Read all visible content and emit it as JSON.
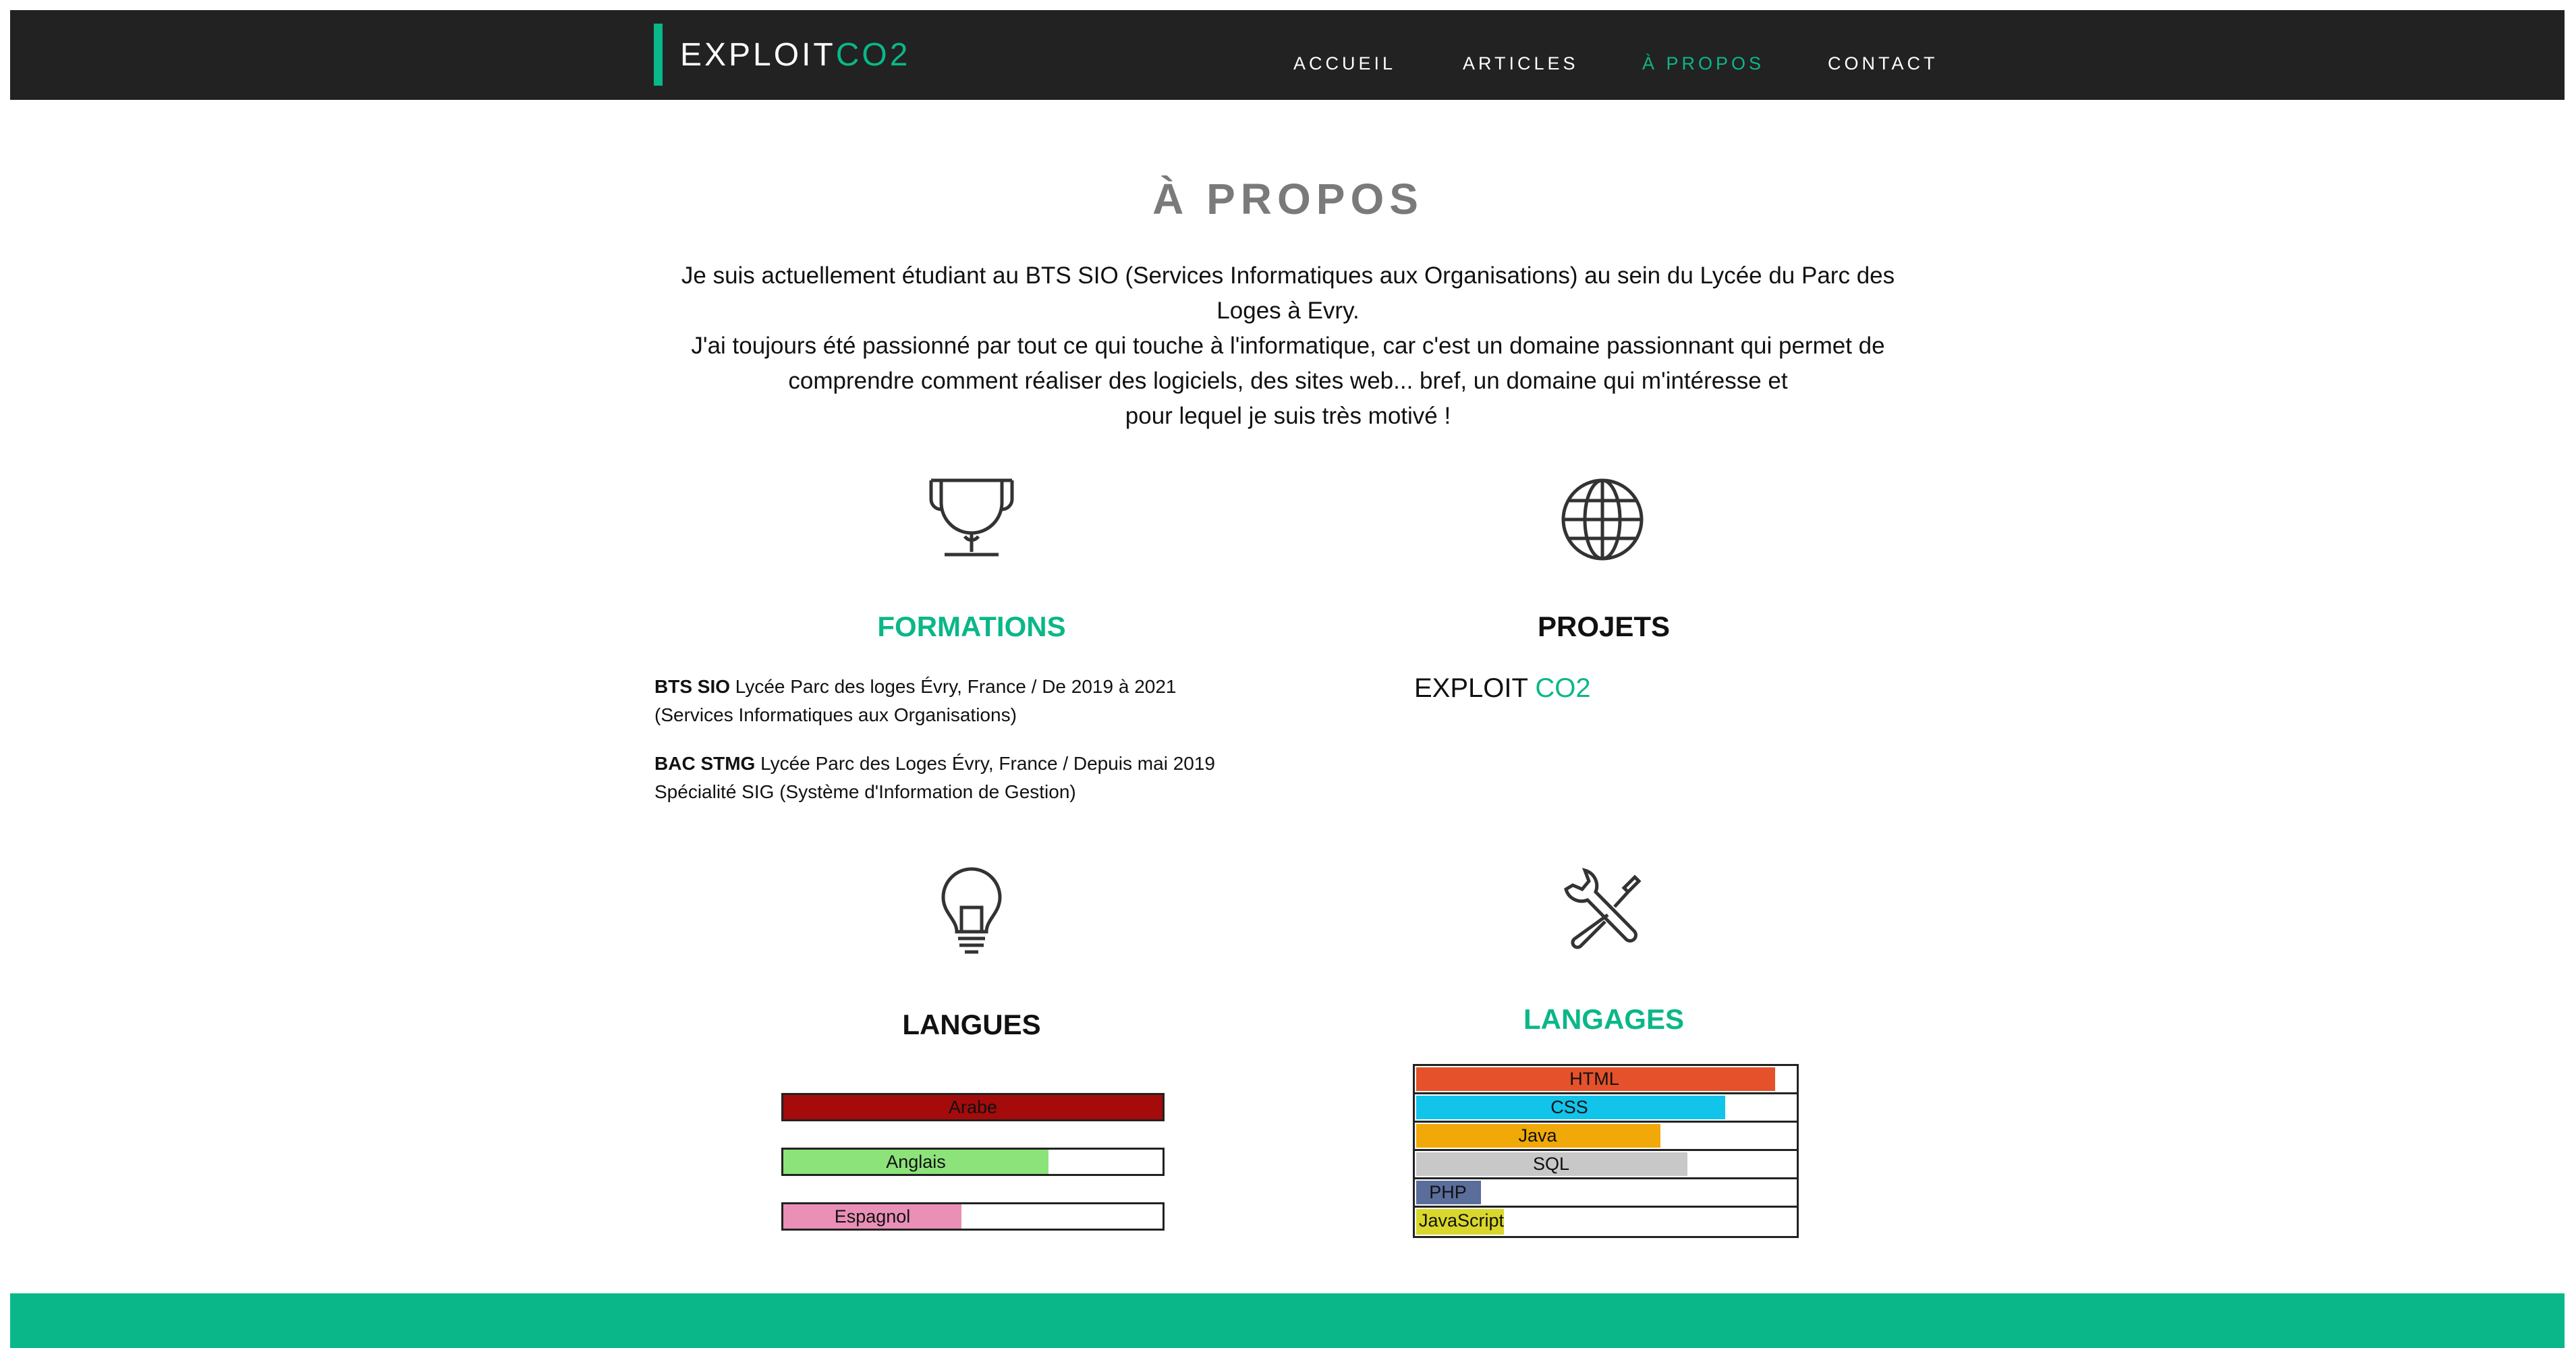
{
  "brand": {
    "name": "EXPLOIT",
    "accent": "CO2"
  },
  "nav": {
    "items": [
      {
        "label": "ACCUEIL"
      },
      {
        "label": "ARTICLES"
      },
      {
        "label": "À PROPOS"
      },
      {
        "label": "CONTACT"
      }
    ],
    "active": "À PROPOS"
  },
  "page": {
    "title": "À PROPOS",
    "intro": [
      "Je suis actuellement étudiant au BTS SIO (Services Informatiques aux Organisations) au sein du Lycée du Parc des Loges à Evry.",
      "J'ai toujours été passionné par tout ce qui touche à l'informatique, car c'est un domaine passionnant qui permet de comprendre comment réaliser des logiciels, des sites web... bref, un domaine qui m'intéresse et",
      "pour lequel je suis très motivé !"
    ]
  },
  "sections": {
    "formations": {
      "title": "FORMATIONS",
      "items": [
        {
          "degree": "BTS SIO",
          "text": " Lycée Parc des loges Évry, France / De 2019 à 2021",
          "detail": "(Services Informatiques aux Organisations)"
        },
        {
          "degree": "BAC STMG",
          "text": " Lycée Parc des Loges Évry, France / Depuis mai 2019",
          "detail": "Spécialité SIG (Système d'Information de Gestion)"
        }
      ]
    },
    "projets": {
      "title": "PROJETS",
      "items": [
        {
          "name": "EXPLOIT ",
          "accent": "CO2"
        }
      ]
    },
    "langues": {
      "title": "LANGUES",
      "items": [
        {
          "label": "Arabe",
          "level": 1.0,
          "color": "#a50b0b"
        },
        {
          "label": "Anglais",
          "level": 0.7,
          "color": "#8ce37a"
        },
        {
          "label": "Espagnol",
          "level": 0.47,
          "color": "#ea8fb6"
        }
      ]
    },
    "langages": {
      "title": "LANGAGES",
      "items": [
        {
          "label": "HTML",
          "level": 0.94,
          "color": "#e4512a"
        },
        {
          "label": "CSS",
          "level": 0.81,
          "color": "#12c3ea"
        },
        {
          "label": "Java",
          "level": 0.64,
          "color": "#f0a909"
        },
        {
          "label": "SQL",
          "level": 0.71,
          "color": "#c8c8c8"
        },
        {
          "label": "PHP",
          "level": 0.17,
          "color": "#5b6d9b"
        },
        {
          "label": "JavaScript",
          "level": 0.23,
          "color": "#d9d72b"
        }
      ]
    }
  },
  "colors": {
    "accent": "#0ab788",
    "navbar": "#222222",
    "title_gray": "#7a7a7a"
  }
}
